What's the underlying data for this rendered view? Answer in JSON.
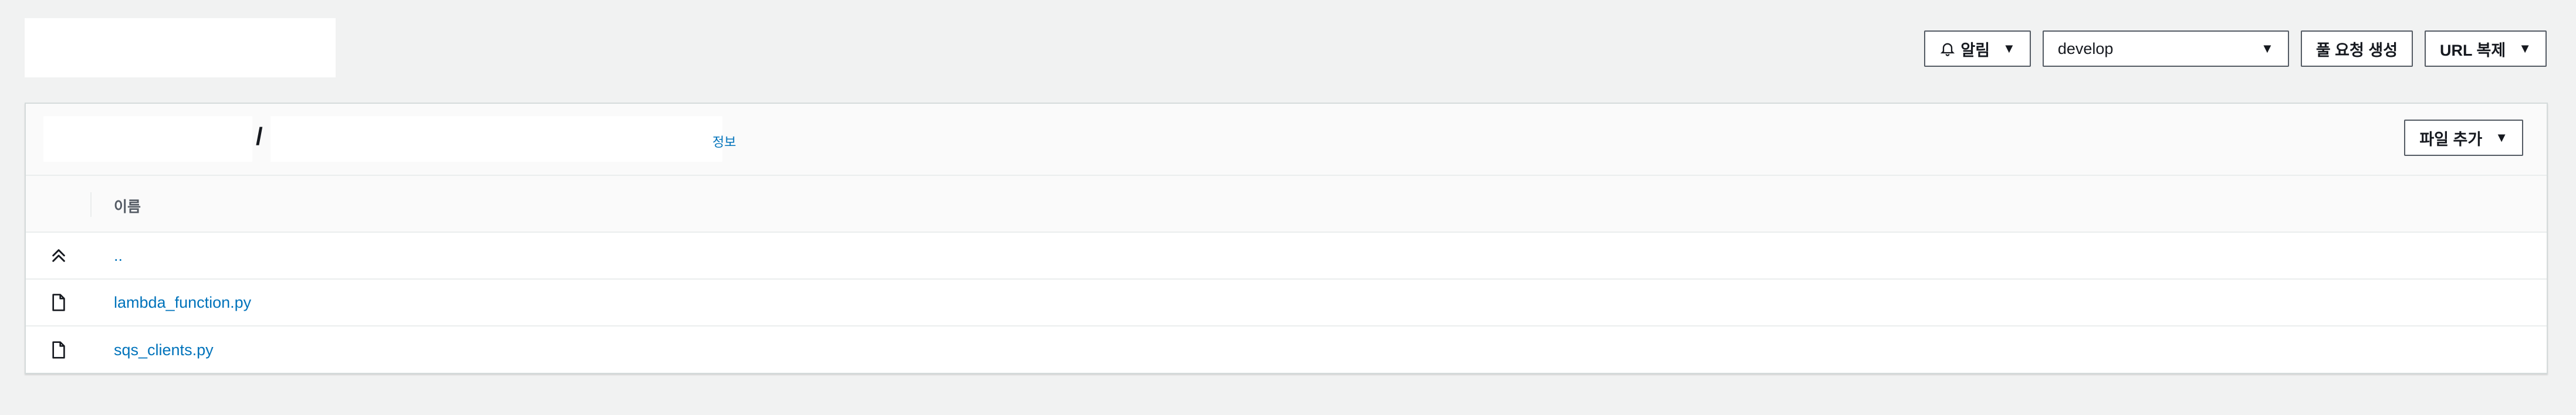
{
  "toolbar": {
    "notify_label": "알림",
    "branch_value": "develop",
    "pull_request_label": "풀 요청 생성",
    "clone_url_label": "URL 복제"
  },
  "panel": {
    "info_label": "정보",
    "add_file_label": "파일 추가",
    "column_name": "이름",
    "rows": [
      {
        "name": "..",
        "icon": "parent-directory-icon"
      },
      {
        "name": "lambda_function.py",
        "icon": "file-icon"
      },
      {
        "name": "sqs_clients.py",
        "icon": "file-icon"
      }
    ]
  },
  "colors": {
    "link": "#0073bb",
    "border": "#545b64",
    "background": "#f1f2f2"
  }
}
